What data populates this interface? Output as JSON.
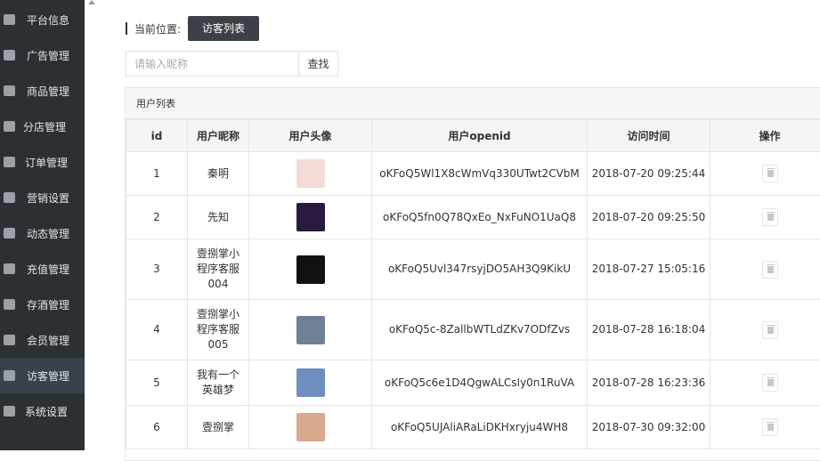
{
  "sidebar": {
    "items": [
      {
        "label": "平台信息",
        "icon": "monitor-icon"
      },
      {
        "label": "广告管理",
        "icon": "globe-icon"
      },
      {
        "label": "商品管理",
        "icon": "cart-icon"
      },
      {
        "label": "分店管理",
        "icon": "building-icon"
      },
      {
        "label": "订单管理",
        "icon": "list-icon"
      },
      {
        "label": "营销设置",
        "icon": "gift-icon"
      },
      {
        "label": "动态管理",
        "icon": "user-icon"
      },
      {
        "label": "充值管理",
        "icon": "gift-icon"
      },
      {
        "label": "存酒管理",
        "icon": "gift-icon"
      },
      {
        "label": "会员管理",
        "icon": "gift-icon"
      },
      {
        "label": "访客管理",
        "icon": "user-icon",
        "active": true
      },
      {
        "label": "系统设置",
        "icon": "gear-icon"
      }
    ]
  },
  "breadcrumb": {
    "label": "当前位置:",
    "current": "访客列表"
  },
  "search": {
    "placeholder": "请输入昵称",
    "value": "",
    "button": "查找"
  },
  "panel": {
    "title": "用户列表"
  },
  "table": {
    "headers": {
      "id": "id",
      "nickname": "用户昵称",
      "avatar": "用户头像",
      "openid": "用户openid",
      "time": "访问时间",
      "action": "操作"
    },
    "rows": [
      {
        "id": "1",
        "nickname": "秦明",
        "openid": "oKFoQ5Wl1X8cWmVq330UTwt2CVbM",
        "time": "2018-07-20 09:25:44",
        "avatar_color": "#f3dcd6"
      },
      {
        "id": "2",
        "nickname": "先知",
        "openid": "oKFoQ5fn0Q78QxEo_NxFuNO1UaQ8",
        "time": "2018-07-20 09:25:50",
        "avatar_color": "#2a1a40"
      },
      {
        "id": "3",
        "nickname": "壹捌掌小程序客服004",
        "openid": "oKFoQ5Uvl347rsyjDO5AH3Q9KikU",
        "time": "2018-07-27 15:05:16",
        "avatar_color": "#111111"
      },
      {
        "id": "4",
        "nickname": "壹捌掌小程序客服005",
        "openid": "oKFoQ5c-8ZallbWTLdZKv7ODfZvs",
        "time": "2018-07-28 16:18:04",
        "avatar_color": "#6f7f96"
      },
      {
        "id": "5",
        "nickname": "我有一个英雄梦",
        "openid": "oKFoQ5c6e1D4QgwALCsIy0n1RuVA",
        "time": "2018-07-28 16:23:36",
        "avatar_color": "#6f8fc0"
      },
      {
        "id": "6",
        "nickname": "壹捌掌",
        "openid": "oKFoQ5UJAliARaLiDKHxryju4WH8",
        "time": "2018-07-30 09:32:00",
        "avatar_color": "#d8a88e"
      }
    ]
  }
}
